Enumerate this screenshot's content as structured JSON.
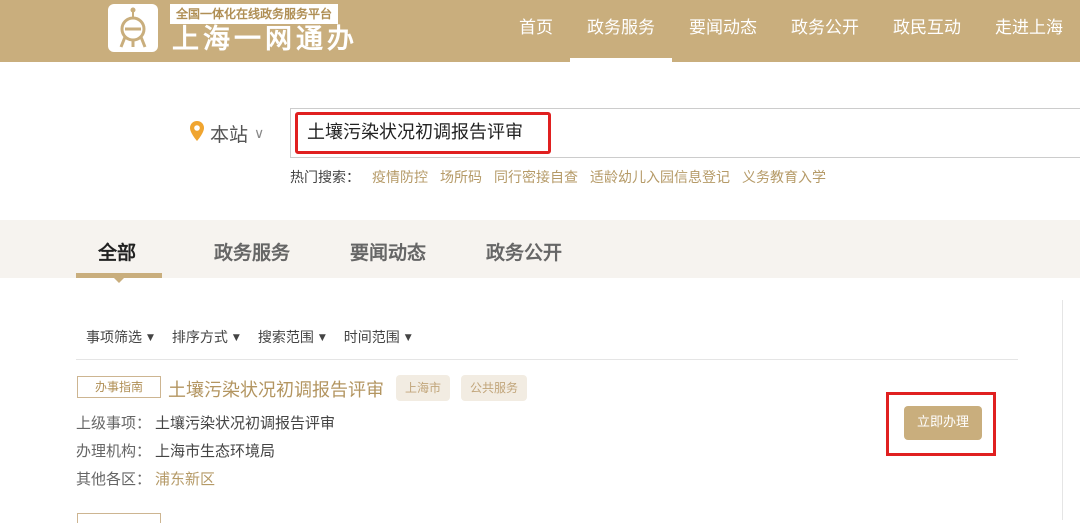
{
  "header": {
    "logo_tag": "全国一体化在线政务服务平台",
    "logo_title": "上海一网通办",
    "nav": [
      "首页",
      "政务服务",
      "要闻动态",
      "政务公开",
      "政民互动",
      "走进上海"
    ],
    "nav_active": 1
  },
  "search": {
    "scope": "本站",
    "query": "土壤污染状况初调报告评审",
    "hot_label": "热门搜索：",
    "hot": [
      "疫情防控",
      "场所码",
      "同行密接自查",
      "适龄幼儿入园信息登记",
      "义务教育入学"
    ]
  },
  "tabs": [
    "全部",
    "政务服务",
    "要闻动态",
    "政务公开"
  ],
  "filters": [
    "事项筛选",
    "排序方式",
    "搜索范围",
    "时间范围"
  ],
  "result": {
    "tag": "办事指南",
    "title": "土壤污染状况初调报告评审",
    "pills": [
      "上海市",
      "公共服务"
    ],
    "parent_label": "上级事项：",
    "parent_value": "土壤污染状况初调报告评审",
    "agency_label": "办理机构：",
    "agency_value": "上海市生态环境局",
    "other_label": "其他各区：",
    "other_value": "浦东新区",
    "apply_label": "立即办理"
  },
  "colors": {
    "brand": "#c9ae7d",
    "highlight": "#e02020"
  }
}
